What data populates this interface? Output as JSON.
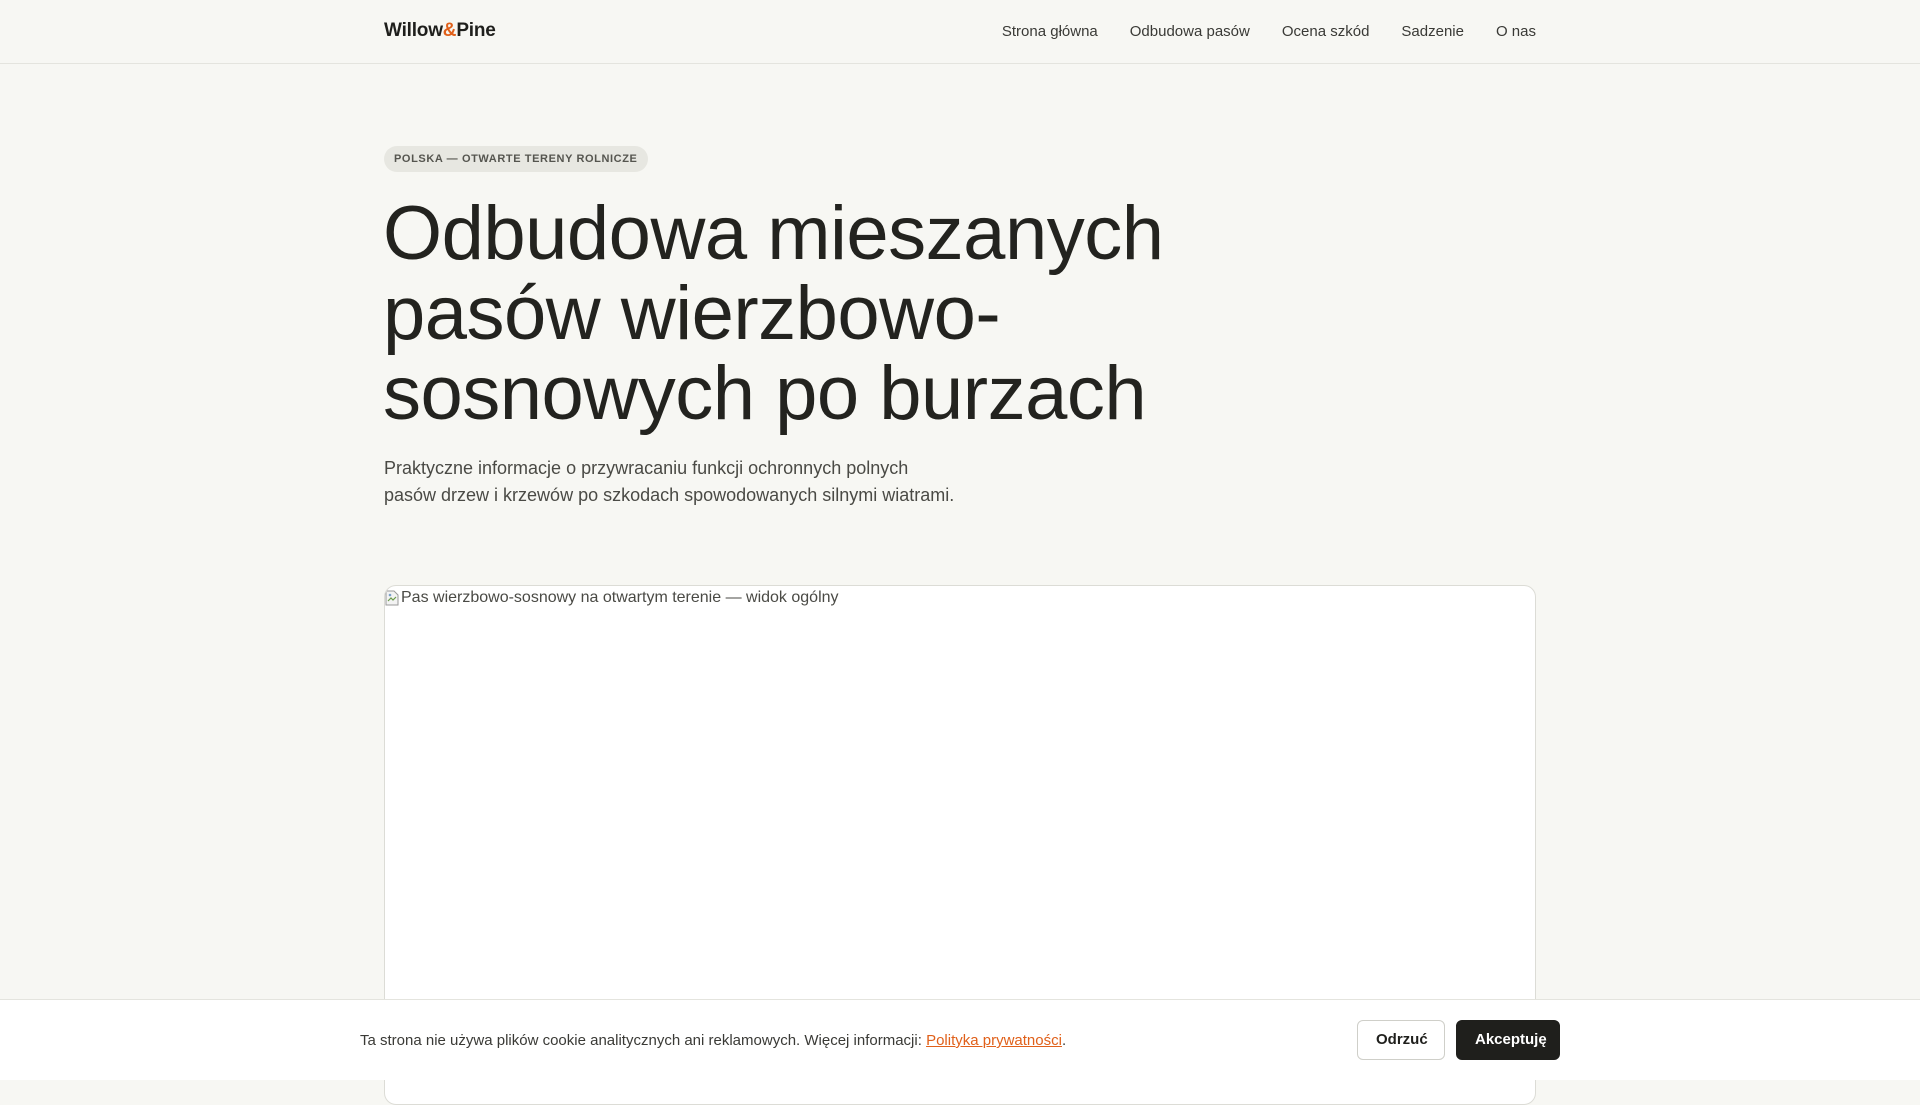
{
  "brand": {
    "part1": "Willow",
    "amp": "&",
    "part2": "Pine"
  },
  "nav": {
    "items": [
      {
        "label": "Strona główna"
      },
      {
        "label": "Odbudowa pasów"
      },
      {
        "label": "Ocena szkód"
      },
      {
        "label": "Sadzenie"
      },
      {
        "label": "O nas"
      }
    ]
  },
  "hero": {
    "eyebrow": "POLSKA — OTWARTE TERENY ROLNICZE",
    "title": "Odbudowa mieszanych pasów wierzbowo-sosnowych po burzach",
    "lede": "Praktyczne informacje o przywracaniu funkcji ochronnych polnych pasów drzew i krzewów po szkodach spowodowanych silnymi wiatrami.",
    "image_alt": "Pas wierzbowo-sosnowy na otwartym terenie — widok ogólny"
  },
  "cookie": {
    "text": "Ta strona nie używa plików cookie analitycznych ani reklamowych. Więcej informacji: ",
    "link_label": "Polityka prywatności",
    "suffix": ".",
    "reject_label": "Odrzuć",
    "accept_label": "Akceptuję"
  },
  "colors": {
    "accent": "#e0601a",
    "background": "#f7f7f3",
    "dark": "#1f1f1c"
  }
}
